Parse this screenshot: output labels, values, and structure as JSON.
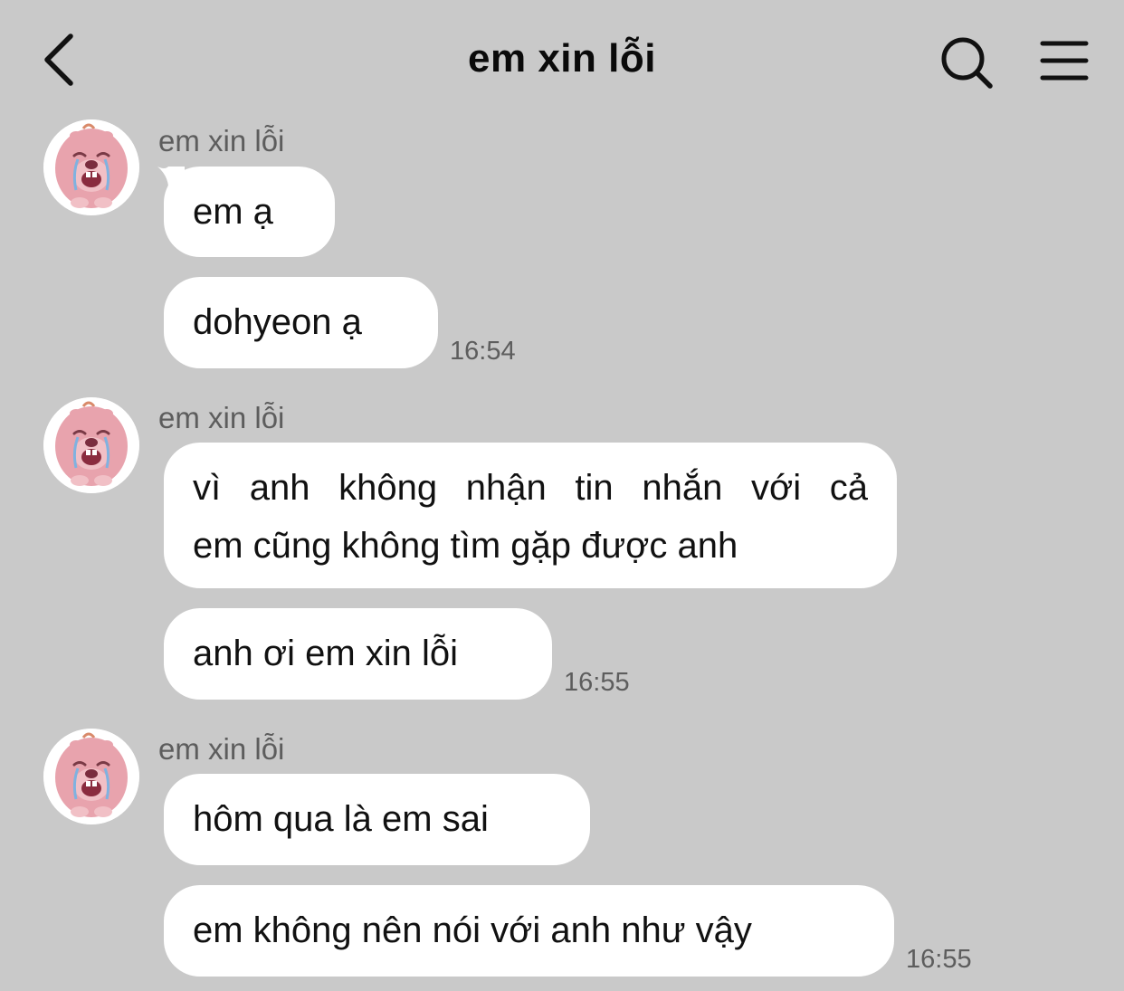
{
  "header": {
    "title": "em xin lỗi"
  },
  "groups": [
    {
      "sender": "em xin lỗi",
      "messages": [
        "em ạ",
        "dohyeon ạ"
      ],
      "time": "16:54"
    },
    {
      "sender": "em xin lỗi",
      "messages": [
        "vì anh không nhận tin nhắn với cả",
        "em cũng không tìm gặp được anh",
        "anh ơi em xin lỗi"
      ],
      "time": "16:55"
    },
    {
      "sender": "em xin lỗi",
      "messages": [
        "hôm qua là em sai",
        "em không nên nói với anh như vậy"
      ],
      "time": "16:55"
    }
  ],
  "colors": {
    "background": "#c9c9c9",
    "bubble": "#ffffff",
    "meta_text": "#5d5d5d",
    "avatar_pink": "#e8a3ad"
  },
  "icons": {
    "back": "chevron-left-icon",
    "search": "search-icon",
    "menu": "hamburger-menu-icon",
    "avatar": "crying-pink-beaver-sticker"
  }
}
